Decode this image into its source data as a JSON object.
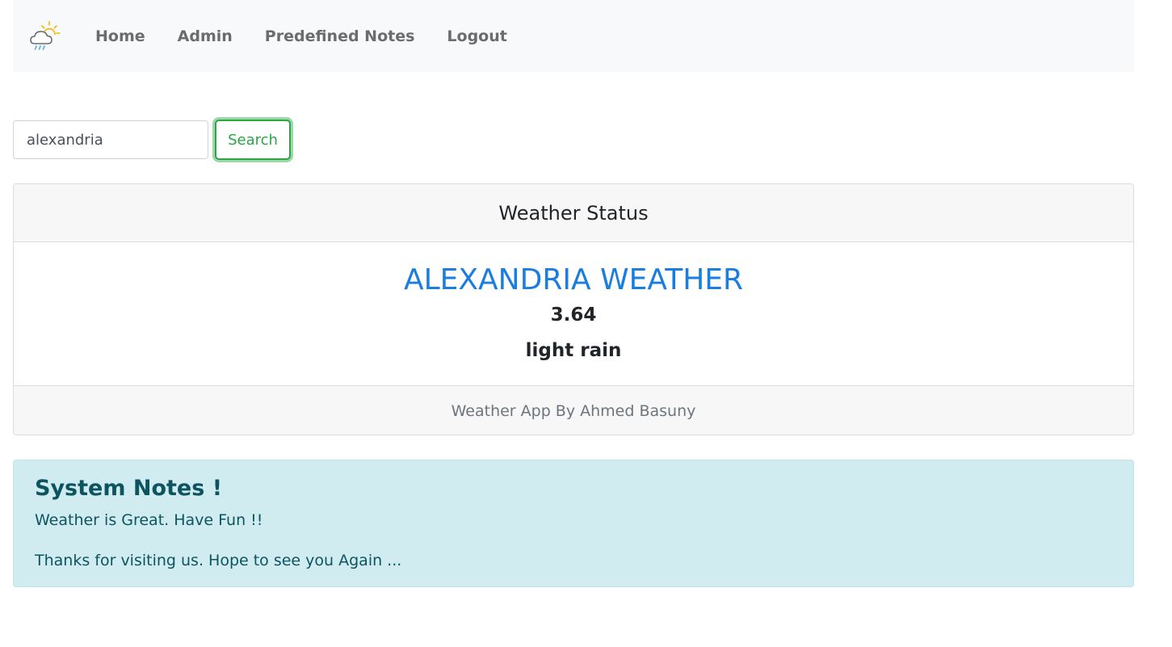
{
  "navbar": {
    "brand_icon": "cloud-sun-rain-icon",
    "links": [
      "Home",
      "Admin",
      "Predefined Notes",
      "Logout"
    ]
  },
  "search": {
    "value": "alexandria",
    "button_label": "Search"
  },
  "weather_card": {
    "header": "Weather Status",
    "city_title": "ALEXANDRIA WEATHER",
    "temperature": "3.64",
    "description": "light rain",
    "footer": "Weather App By Ahmed Basuny"
  },
  "notes": {
    "heading": "System Notes !",
    "lines": [
      "Weather is Great. Have Fun !!",
      "Thanks for visiting us. Hope to see you Again ..."
    ]
  },
  "colors": {
    "accent_blue": "#1a7de0",
    "success_green": "#28a745",
    "info_bg": "#d1ecf1",
    "info_text": "#0c5460"
  }
}
